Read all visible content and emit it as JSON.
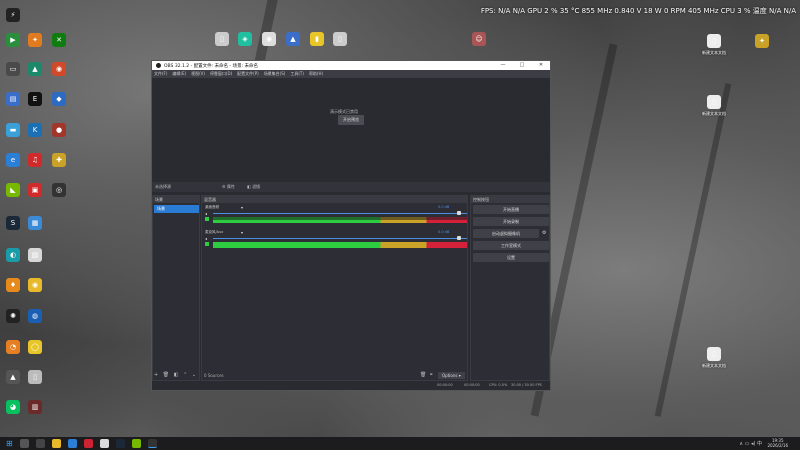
{
  "stats": "FPS: N/A  N/A   GPU 2 %  35 °C  855 MHz  0.840 V  18 W  0 RPM  405 MHz   CPU 3 %   温度 N/A  N/A",
  "desktop_labels": {
    "file1": "新建文本文档",
    "file2": "新建文本文档",
    "file3": "新建文本文档"
  },
  "window": {
    "title": "OBS 32.1.2 - 配置文件: 未命名 - 场景: 未命名",
    "controls": [
      "—",
      "□",
      "✕"
    ],
    "menu": [
      "文件(F)",
      "编辑(E)",
      "视图(V)",
      "停靠窗口(D)",
      "配置文件(P)",
      "场景集合(S)",
      "工具(T)",
      "帮助(H)"
    ]
  },
  "preview": {
    "hint": "演示模式已禁用",
    "studio_button": "开启预览"
  },
  "tabs": {
    "scenes_tab": "未选择源",
    "properties": "属性",
    "filters": "滤镜"
  },
  "scenes": {
    "header": "场景",
    "items": [
      "场景"
    ]
  },
  "mixer": {
    "header": "混音器",
    "channels": [
      {
        "name": "桌面音频",
        "db": "0.0 dB",
        "level": 0.87
      },
      {
        "name": "麦克风/Aux",
        "db": "0.0 dB",
        "level": 0.95
      }
    ]
  },
  "controls": {
    "header": "控制按钮",
    "buttons": [
      "开始直播",
      "开始录制",
      "启动虚拟摄像机",
      "工作室模式",
      "设置"
    ]
  },
  "toolbar": {
    "source_count": "0 Sources",
    "options": "Options"
  },
  "statusbar": {
    "timer1": "00:00:00",
    "timer2": "00:00:00",
    "cpu": "CPU: 0.0%",
    "fps": "30.00 / 30.00 FPS"
  },
  "taskbar": {
    "time": "19:35",
    "date": "2026/2/16"
  }
}
